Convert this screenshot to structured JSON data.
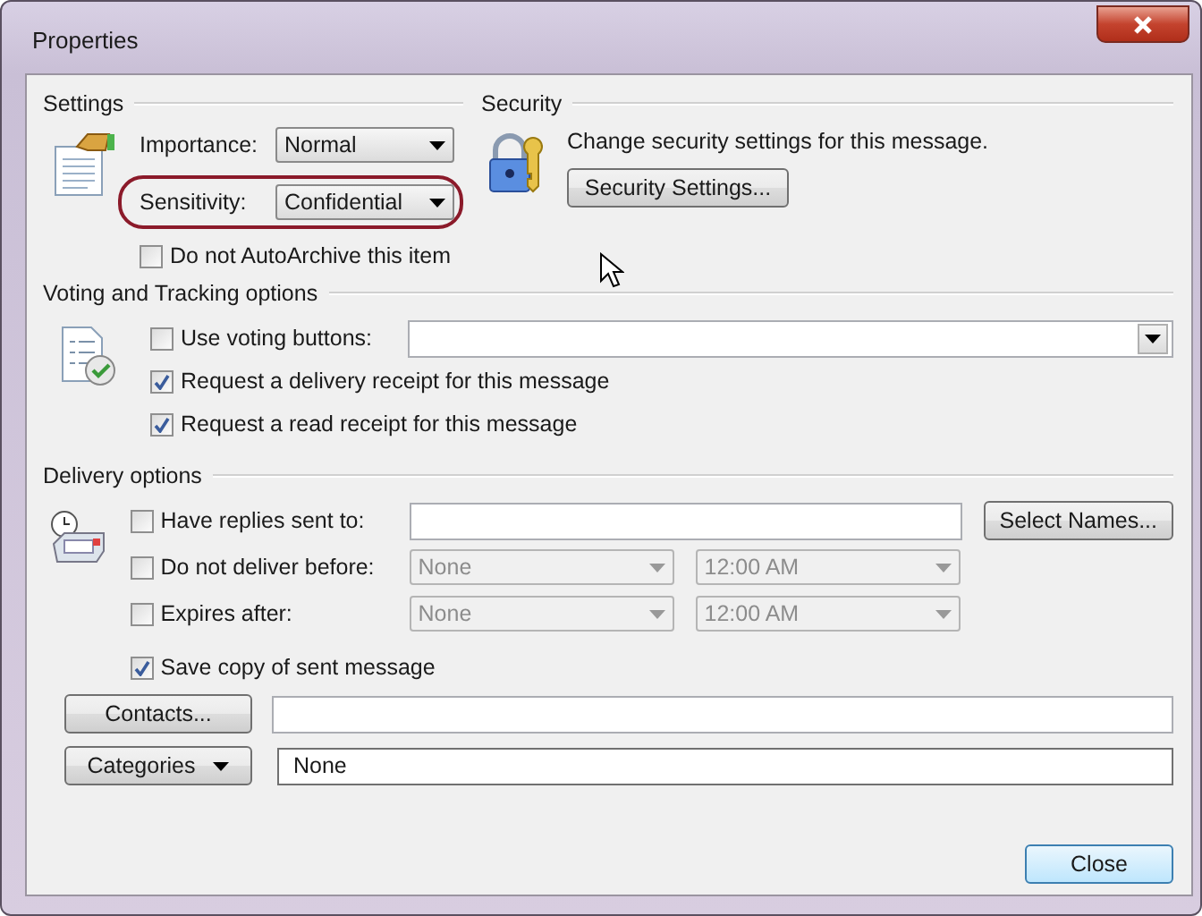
{
  "window": {
    "title": "Properties"
  },
  "settings": {
    "heading": "Settings",
    "importance": {
      "label": "Importance:",
      "value": "Normal"
    },
    "sensitivity": {
      "label": "Sensitivity:",
      "value": "Confidential",
      "highlighted": true
    },
    "auto_archive": {
      "label": "Do not AutoArchive this item",
      "checked": false
    }
  },
  "security": {
    "heading": "Security",
    "text": "Change security settings for this message.",
    "button": "Security Settings..."
  },
  "voting": {
    "heading": "Voting and Tracking options",
    "voting_buttons": {
      "label": "Use voting buttons:",
      "checked": false
    },
    "receipts": [
      {
        "label": "Request a delivery receipt for this message",
        "checked": true
      },
      {
        "label": "Request a read receipt for this message",
        "checked": true
      }
    ]
  },
  "delivery": {
    "heading": "Delivery options",
    "replies": {
      "label": "Have replies sent to:",
      "checked": false,
      "button": "Select Names..."
    },
    "schedule": [
      {
        "label": "Do not deliver before:",
        "checked": false,
        "date": "None",
        "time": "12:00 AM",
        "disabled": true
      },
      {
        "label": "Expires after:",
        "checked": false,
        "date": "None",
        "time": "12:00 AM",
        "disabled": true
      }
    ],
    "save_copy": {
      "label": "Save copy of sent message",
      "checked": true
    }
  },
  "contacts": {
    "button": "Contacts..."
  },
  "categories": {
    "button": "Categories",
    "value": "None"
  },
  "footer": {
    "button": "Close"
  }
}
